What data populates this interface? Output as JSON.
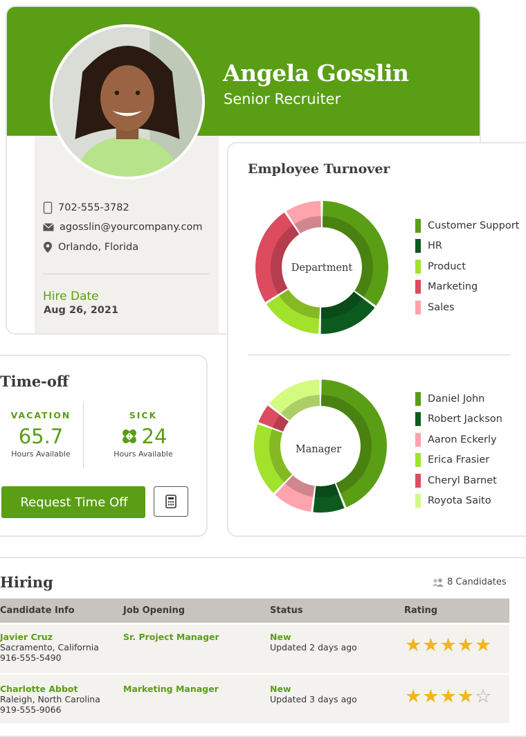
{
  "profile": {
    "name": "Angela Gosslin",
    "title": "Senior Recruiter",
    "phone": "702-555-3782",
    "email": "agosslin@yourcompany.com",
    "location": "Orlando, Florida",
    "hire_date_label": "Hire Date",
    "hire_date": "Aug 26, 2021"
  },
  "turnover": {
    "title": "Employee Turnover",
    "department_label": "Department",
    "manager_label": "Manager",
    "department_legend": [
      {
        "name": "Customer Support",
        "color": "#5a9e15"
      },
      {
        "name": "HR",
        "color": "#0d5a1e"
      },
      {
        "name": "Product",
        "color": "#a2e22c"
      },
      {
        "name": "Marketing",
        "color": "#dd4b5e"
      },
      {
        "name": "Sales",
        "color": "#ffa3ad"
      }
    ],
    "manager_legend": [
      {
        "name": "Daniel John",
        "color": "#5a9e15"
      },
      {
        "name": "Robert Jackson",
        "color": "#0d5a1e"
      },
      {
        "name": "Aaron Eckerly",
        "color": "#ffa3ad"
      },
      {
        "name": "Erica Frasier",
        "color": "#a2e22c"
      },
      {
        "name": "Cheryl Barnet",
        "color": "#dd4b5e"
      },
      {
        "name": "Royota Saito",
        "color": "#d2fb80"
      }
    ]
  },
  "chart_data": [
    {
      "type": "pie",
      "title": "Department",
      "categories": [
        "Customer Support",
        "HR",
        "Product",
        "Marketing",
        "Sales"
      ],
      "values": [
        34,
        15,
        15,
        24,
        9
      ]
    },
    {
      "type": "pie",
      "title": "Manager",
      "categories": [
        "Daniel John",
        "Robert Jackson",
        "Aaron Eckerly",
        "Erica Frasier",
        "Cheryl Barnet",
        "Royota Saito"
      ],
      "values": [
        43,
        8,
        10,
        18,
        5,
        14
      ]
    }
  ],
  "timeoff": {
    "title": "Time-off",
    "vacation_label": "VACATION",
    "vacation_hours": "65.7",
    "sick_label": "SICK",
    "sick_hours": "24",
    "hours_available": "Hours Available",
    "request_label": "Request Time Off"
  },
  "candidates": {
    "title": "Hiring",
    "count": "8 Candidates",
    "columns": [
      "Candidate Info",
      "Job Opening",
      "Status",
      "Rating"
    ],
    "rows": [
      {
        "name": "Javier Cruz",
        "location": "Sacramento, California",
        "phone": "916-555-5490",
        "job": "Sr. Project Manager",
        "status": "New",
        "updated": "Updated 2 days ago",
        "rating": 5
      },
      {
        "name": "Charlotte Abbot",
        "location": "Raleigh, North Carolina",
        "phone": "919-555-9066",
        "job": "Marketing Manager",
        "status": "New",
        "updated": "Updated 3 days ago",
        "rating": 4
      }
    ]
  }
}
